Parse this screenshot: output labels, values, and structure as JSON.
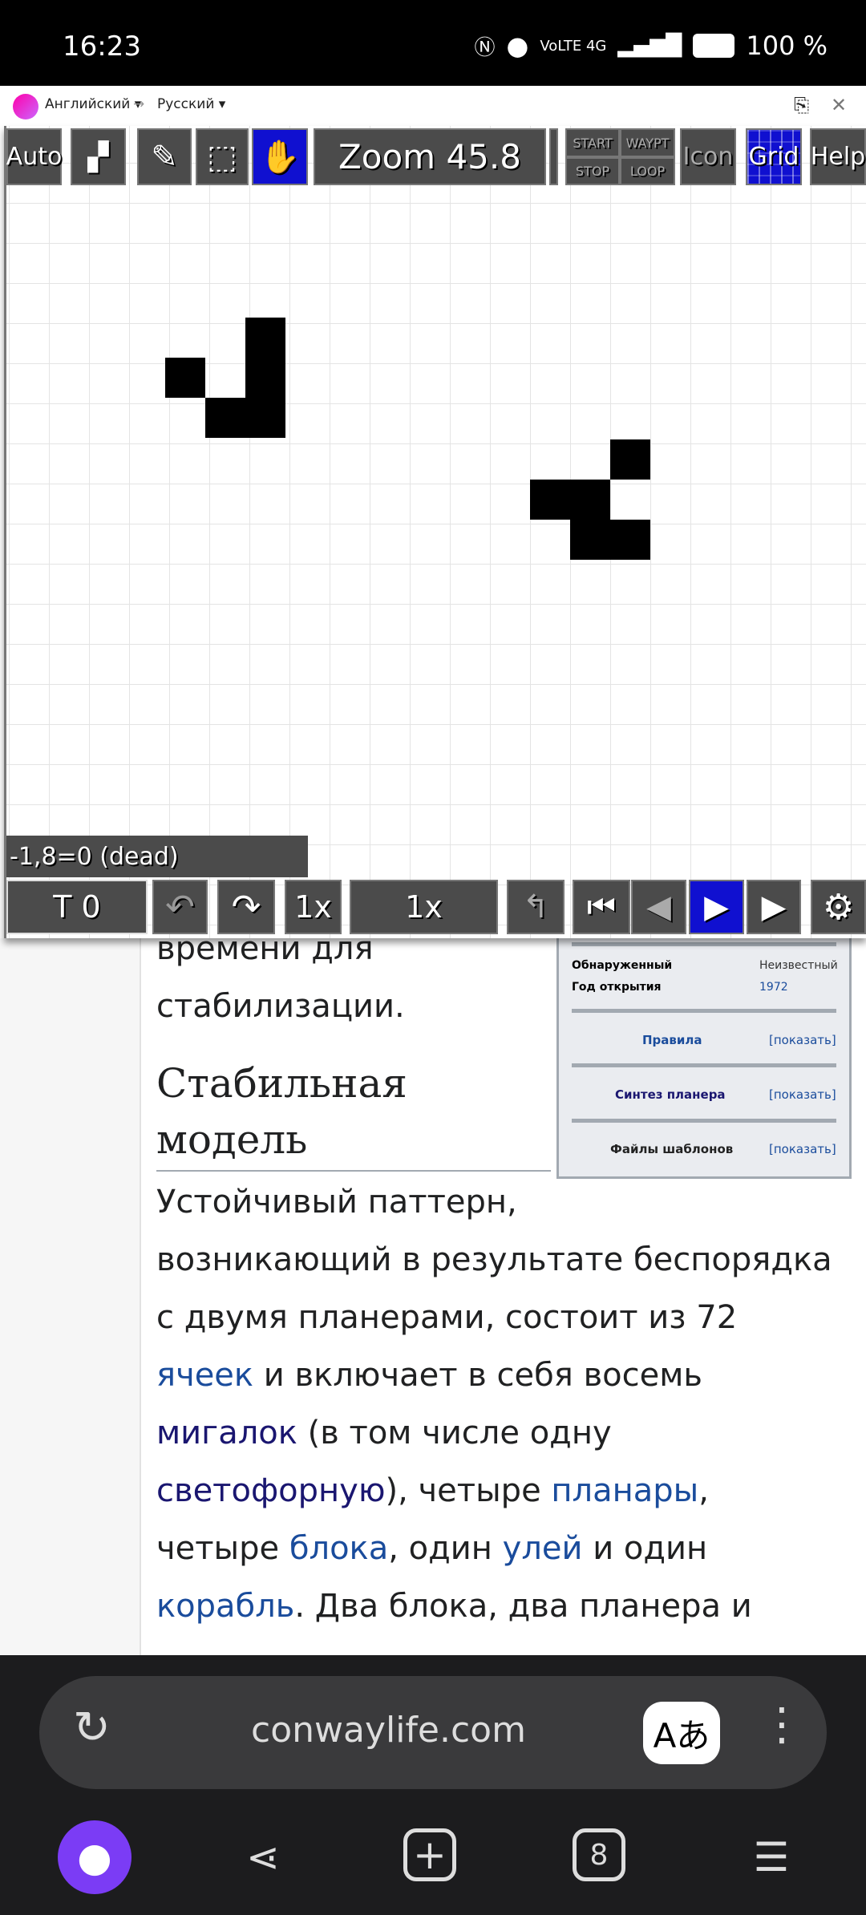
{
  "status_bar": {
    "time": "16:23",
    "battery": "100 %",
    "network": "VoLTE 4G"
  },
  "translate_bar": {
    "from_lang": "Английский ▾",
    "arrow": "→",
    "to_lang": "Русский ▾",
    "close": "✕"
  },
  "toolbar": {
    "auto": "Auto",
    "zoom": "Zoom 45.8",
    "start": "START",
    "waypt": "WAYPT",
    "stop": "STOP",
    "loop": "LOOP",
    "icon": "Icon",
    "grid": "Grid",
    "help": "Help"
  },
  "canvas": {
    "cell_readout": "-1,8=0 (dead)",
    "gliders": [
      [
        [
          2,
          0
        ],
        [
          0,
          1
        ],
        [
          2,
          1
        ],
        [
          1,
          2
        ],
        [
          2,
          2
        ]
      ],
      [
        [
          2,
          0
        ],
        [
          0,
          1
        ],
        [
          1,
          1
        ],
        [
          1,
          2
        ],
        [
          2,
          2
        ]
      ]
    ]
  },
  "playback": {
    "generation": "T 0",
    "step": "1x",
    "speed": "1x"
  },
  "article": {
    "lines_top": [
      "времени для",
      "стабилизации."
    ],
    "heading": [
      "Стабильная",
      "модель"
    ],
    "p1": "Устойчивый паттерн,",
    "p2": "возникающий в результате беспорядка",
    "p3": "с двумя планерами, состоит из 72",
    "link_cells": "ячеек",
    "p4": " и включает в себя восемь",
    "link_blinkers": "мигалок",
    "p5": " (в том числе одну",
    "link_traffic": "светофорную",
    "p6": "), четыре ",
    "link_gliders": "планары",
    "p7": ",",
    "p8": "четыре ",
    "link_blocks": "блока",
    "p9": ", один ",
    "link_hive": "улей",
    "p10": " и один",
    "link_ship": "корабль",
    "p11": ". Два блока, два планера и"
  },
  "infobox": {
    "discovered_label": "Обнаруженный",
    "discovered_value": "Неизвестный",
    "year_label": "Год открытия",
    "year_value": "1972",
    "sections": [
      {
        "title": "Правила",
        "toggle": "[показать]"
      },
      {
        "title": "Синтез планера",
        "toggle": "[показать]"
      },
      {
        "title": "Файлы шаблонов",
        "toggle": "[показать]"
      }
    ]
  },
  "browser": {
    "url": "conwaylife.com",
    "tabs_count": "8"
  }
}
